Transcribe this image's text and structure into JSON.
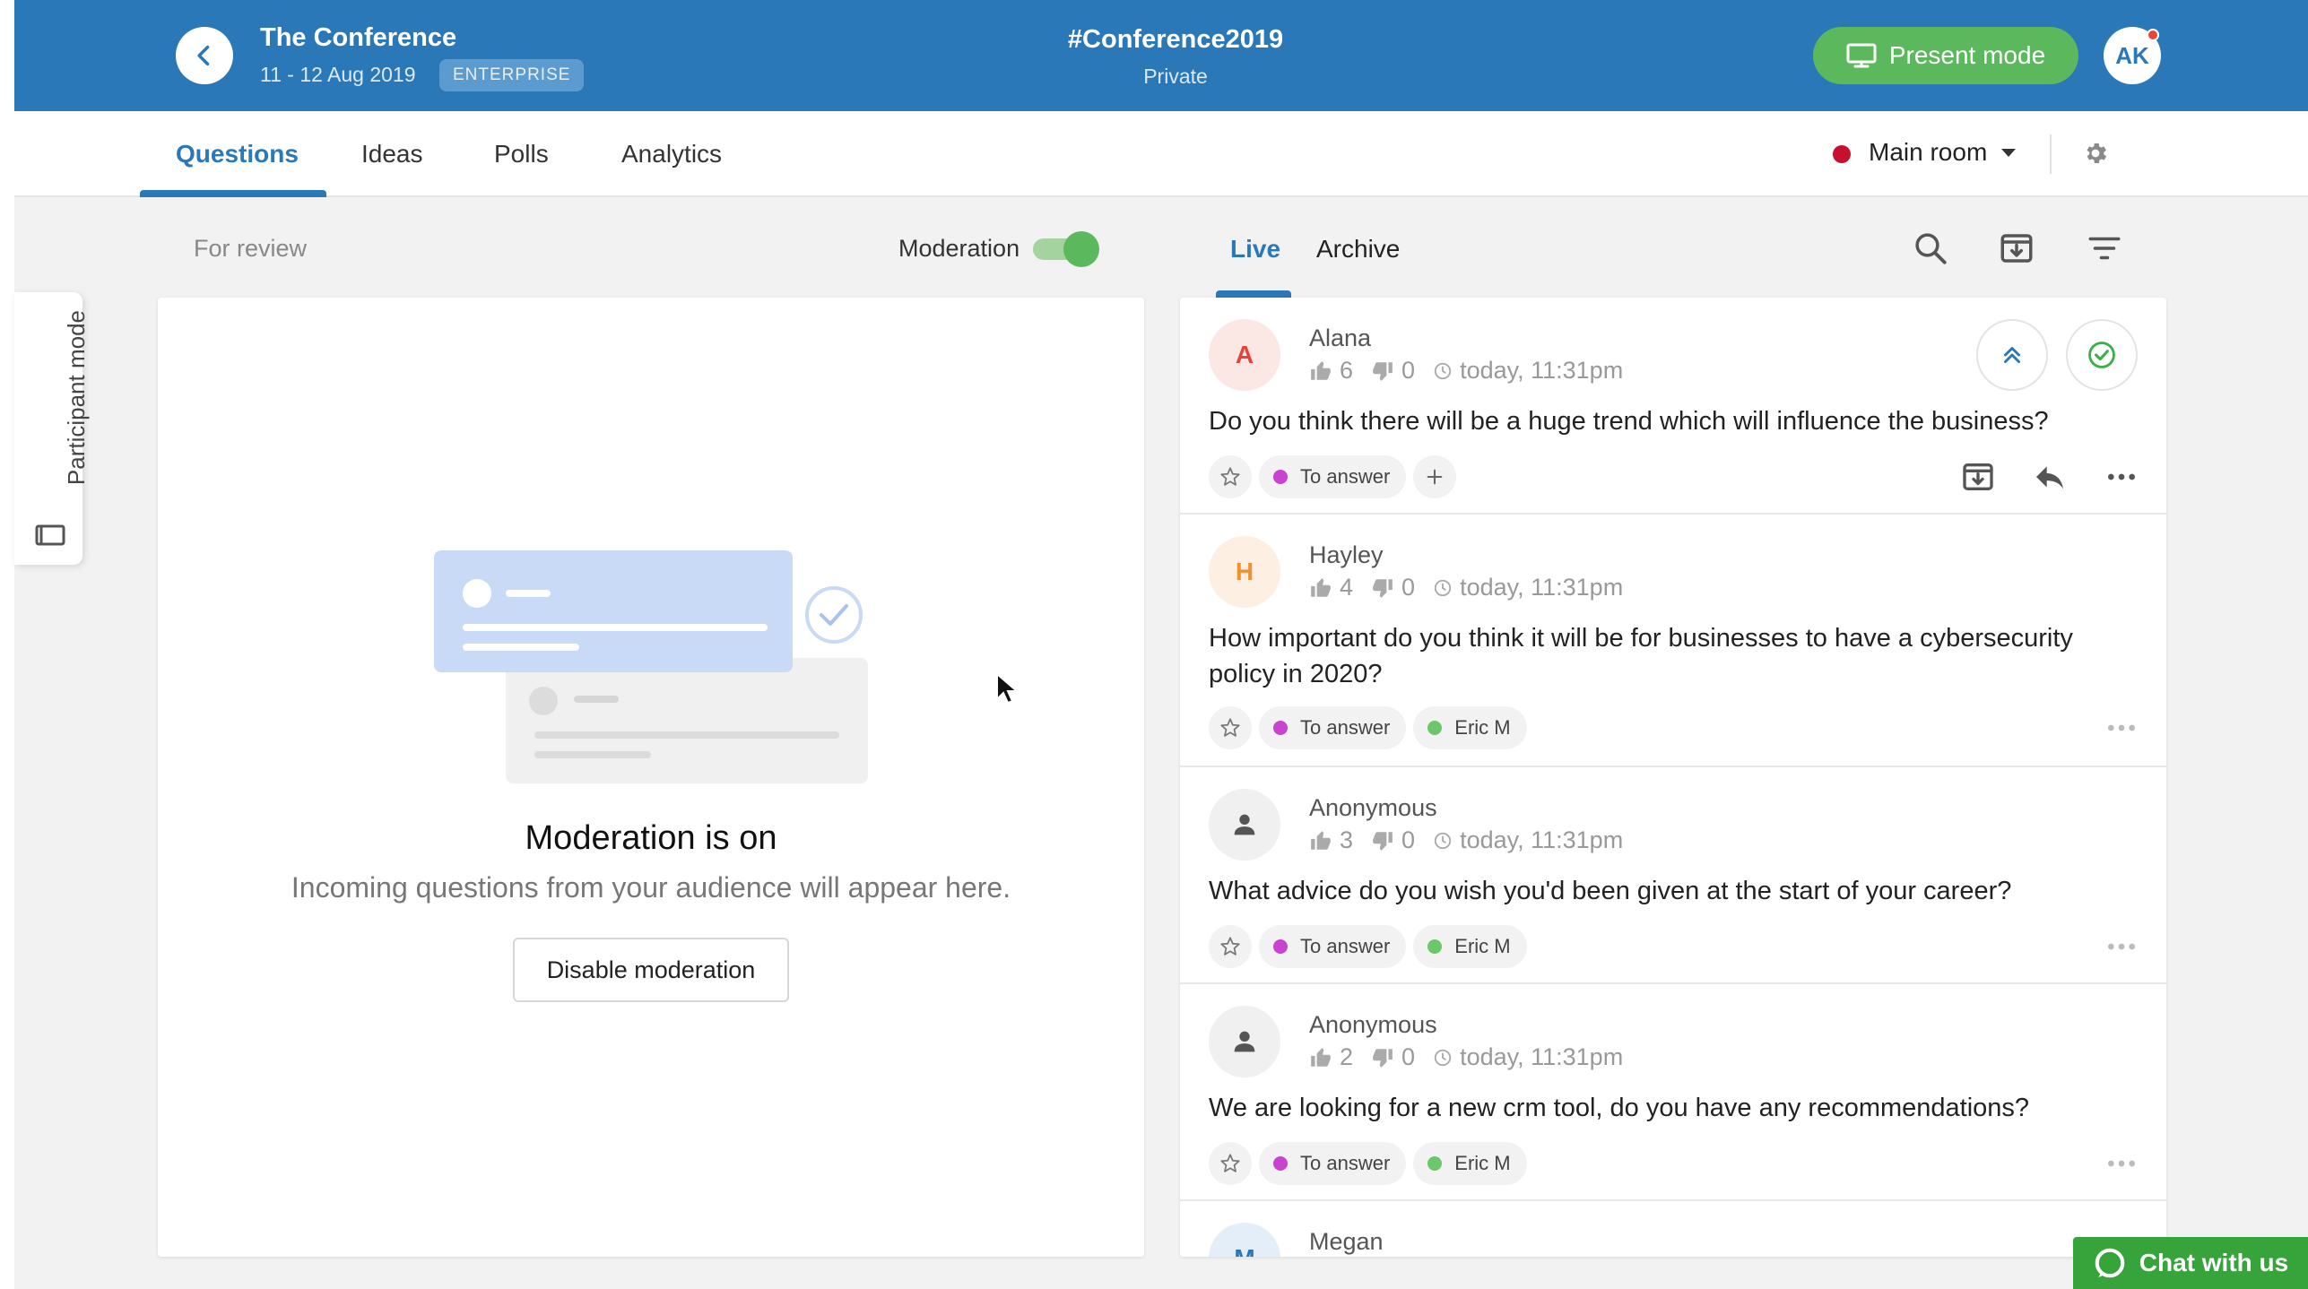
{
  "header": {
    "event_title": "The Conference",
    "event_date": "11 - 12 Aug 2019",
    "plan_badge": "ENTERPRISE",
    "hashtag": "#Conference2019",
    "privacy": "Private",
    "present_label": "Present mode",
    "user_initials": "AK",
    "brand_color": "#2a78b8"
  },
  "nav": {
    "tabs": [
      {
        "label": "Questions",
        "active": true
      },
      {
        "label": "Ideas",
        "active": false
      },
      {
        "label": "Polls",
        "active": false
      },
      {
        "label": "Analytics",
        "active": false
      }
    ],
    "room_label": "Main room",
    "room_color": "#c8102e"
  },
  "sidebar": {
    "participant_mode_label": "Participant mode"
  },
  "review": {
    "for_review_label": "For review",
    "moderation_label": "Moderation",
    "moderation_on": true,
    "empty_title": "Moderation is on",
    "empty_subtitle": "Incoming questions from your audience will appear here.",
    "disable_button": "Disable moderation"
  },
  "live": {
    "tabs": [
      {
        "label": "Live",
        "active": true
      },
      {
        "label": "Archive",
        "active": false
      }
    ],
    "questions": [
      {
        "initial": "A",
        "author": "Alana",
        "likes": "6",
        "dislikes": "0",
        "time": "today, 11:31pm",
        "text": "Do you think there will be a huge trend which will influence the business?",
        "status": "To answer",
        "assignee": ""
      },
      {
        "initial": "H",
        "author": "Hayley",
        "likes": "4",
        "dislikes": "0",
        "time": "today, 11:31pm",
        "text": "How important do you think it will be for businesses to have a cybersecurity policy in 2020?",
        "status": "To answer",
        "assignee": "Eric M"
      },
      {
        "initial": "",
        "author": "Anonymous",
        "likes": "3",
        "dislikes": "0",
        "time": "today, 11:31pm",
        "text": "What advice do you wish you'd been given at the start of your career?",
        "status": "To answer",
        "assignee": "Eric M"
      },
      {
        "initial": "",
        "author": "Anonymous",
        "likes": "2",
        "dislikes": "0",
        "time": "today, 11:31pm",
        "text": "We are looking for a new crm tool, do you have any recommendations?",
        "status": "To answer",
        "assignee": "Eric M"
      },
      {
        "initial": "M",
        "author": "Megan",
        "likes": "",
        "dislikes": "",
        "time": "",
        "text": "",
        "status": "",
        "assignee": ""
      }
    ]
  },
  "chat": {
    "label": "Chat with us"
  }
}
